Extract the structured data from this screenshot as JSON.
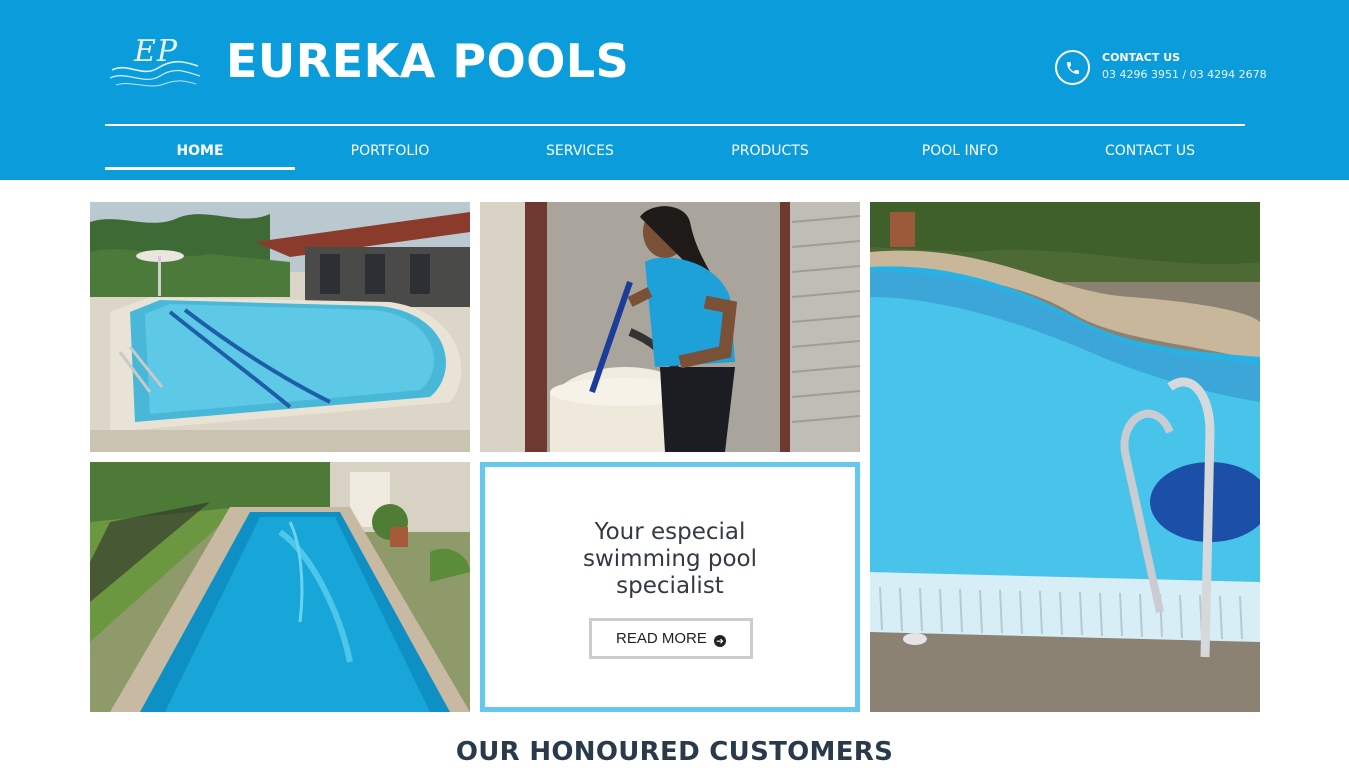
{
  "header": {
    "logo_initials": "EP",
    "brand_name": "EUREKA POOLS",
    "contact_title": "CONTACT US",
    "contact_phones": "03 4296 3951 / 03 4294 2678",
    "bg_color": "#0b9ddb"
  },
  "nav": {
    "items": [
      {
        "label": "HOME",
        "active": true
      },
      {
        "label": "PORTFOLIO",
        "active": false
      },
      {
        "label": "SERVICES",
        "active": false
      },
      {
        "label": "PRODUCTS",
        "active": false
      },
      {
        "label": "POOL INFO",
        "active": false
      },
      {
        "label": "CONTACT US",
        "active": false
      }
    ]
  },
  "gallery": {
    "promo_text": "Your especial swimming pool specialist",
    "read_more_label": "READ MORE",
    "promo_border_color": "#67c8ee"
  },
  "icons": {
    "phone": "phone-icon",
    "read_more": "circle-arrow-right-icon"
  },
  "section": {
    "title": "OUR HONOURED CUSTOMERS"
  }
}
